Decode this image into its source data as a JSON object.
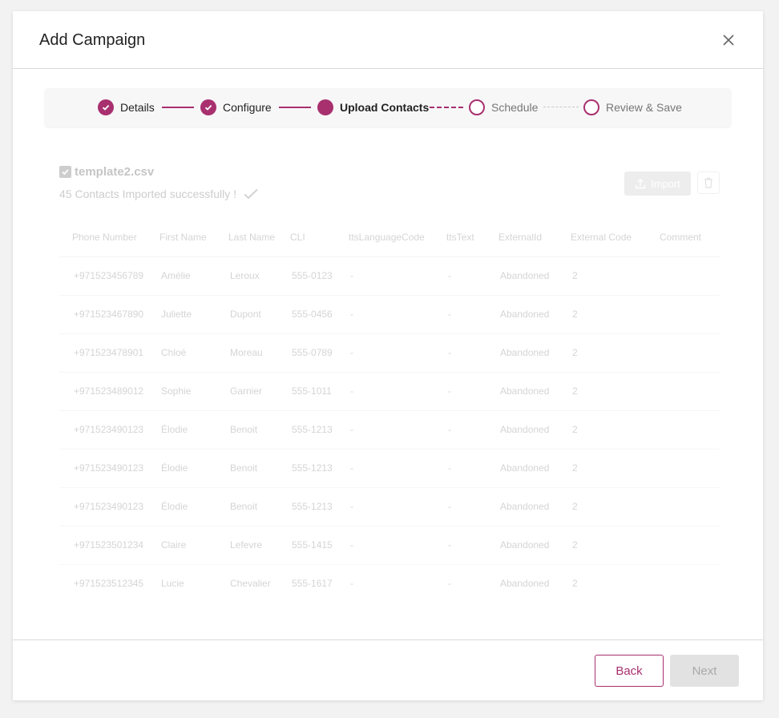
{
  "modal": {
    "title": "Add Campaign"
  },
  "stepper": {
    "steps": [
      {
        "label": "Details",
        "state": "done"
      },
      {
        "label": "Configure",
        "state": "done"
      },
      {
        "label": "Upload Contacts",
        "state": "active"
      },
      {
        "label": "Schedule",
        "state": "todo"
      },
      {
        "label": "Review & Save",
        "state": "todo"
      }
    ]
  },
  "upload": {
    "file_name": "template2.csv",
    "success_message": "45 Contacts Imported successfully !",
    "import_label": "Import"
  },
  "table": {
    "columns": [
      "Phone Number",
      "First Name",
      "Last Name",
      "CLI",
      "ttsLanguageCode",
      "ttsText",
      "ExternalId",
      "External Code",
      "Comment"
    ],
    "rows": [
      [
        "+971523456789",
        "Amélie",
        "Leroux",
        "555-0123",
        "-",
        "-",
        "Abandoned",
        "2",
        ""
      ],
      [
        "+971523467890",
        "Juliette",
        "Dupont",
        "555-0456",
        "-",
        "-",
        "Abandoned",
        "2",
        ""
      ],
      [
        "+971523478901",
        "Chloé",
        "Moreau",
        "555-0789",
        "-",
        "-",
        "Abandoned",
        "2",
        ""
      ],
      [
        "+971523489012",
        "Sophie",
        "Garnier",
        "555-1011",
        "-",
        "-",
        "Abandoned",
        "2",
        ""
      ],
      [
        "+971523490123",
        "Élodie",
        "Benoit",
        "555-1213",
        "-",
        "-",
        "Abandoned",
        "2",
        ""
      ],
      [
        "+971523490123",
        "Élodie",
        "Benoit",
        "555-1213",
        "-",
        "-",
        "Abandoned",
        "2",
        ""
      ],
      [
        "+971523490123",
        "Élodie",
        "Benoit",
        "555-1213",
        "-",
        "-",
        "Abandoned",
        "2",
        ""
      ],
      [
        "+971523501234",
        "Claire",
        "Lefevre",
        "555-1415",
        "-",
        "-",
        "Abandoned",
        "2",
        ""
      ],
      [
        "+971523512345",
        "Lucie",
        "Chevalier",
        "555-1617",
        "-",
        "-",
        "Abandoned",
        "2",
        ""
      ]
    ]
  },
  "footer": {
    "back_label": "Back",
    "next_label": "Next"
  },
  "colors": {
    "accent": "#a8306f",
    "disabled_bg": "#e2e2e2"
  }
}
